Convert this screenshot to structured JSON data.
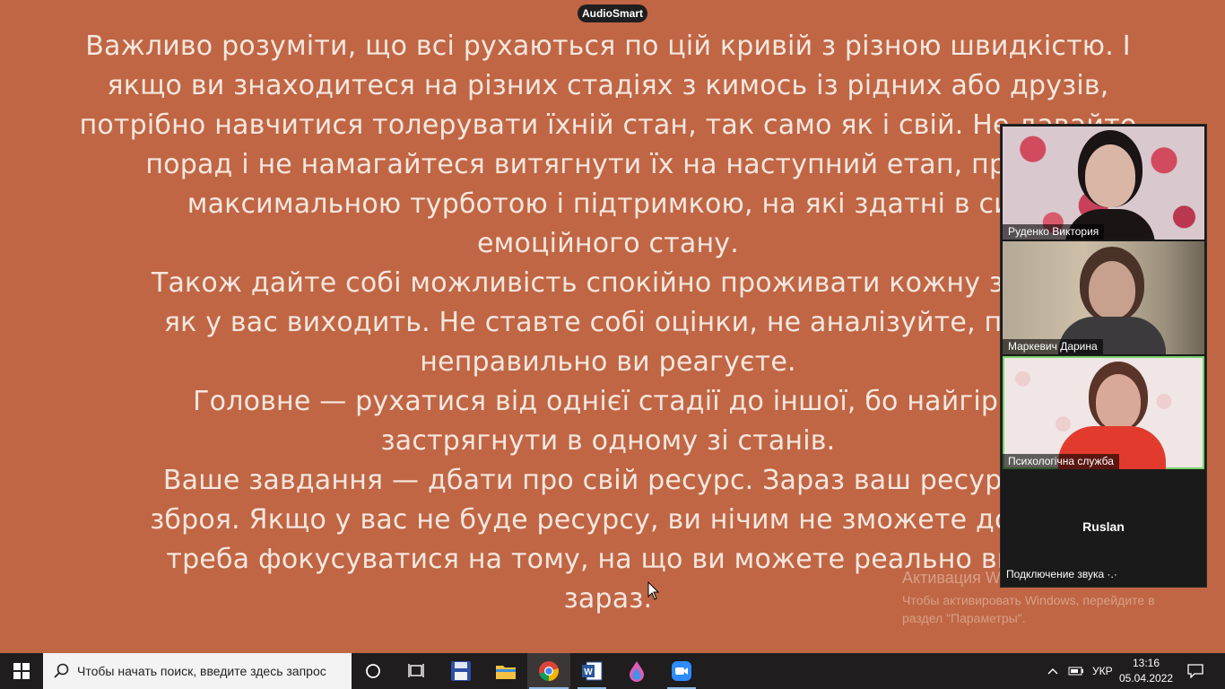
{
  "slide": {
    "lines": [
      "Важливо розуміти, що всі рухаються по цій кривій з різною швидкістю. І",
      "якщо ви знаходитеся на різних стадіях з кимось із рідних або друзів,",
      "потрібно навчитися толерувати їхній стан, так само як і свій. Не давайте",
      "порад і не намагайтеся витягнути їх на наступний етап, просто",
      "максимальною турботою і підтримкою, на які здатні в сил",
      "емоційного стану.",
      "Також дайте собі можливість спокійно проживати кожну з цих",
      "як у вас виходить. Не ставте собі оцінки, не аналізуйте, прав",
      "неправильно ви реагуєте.",
      "Головне — рухатися від однієї стадії до іншої, бо найгірш",
      "застрягнути в одному зі станів.",
      "Ваше завдання — дбати про свій ресурс. Зараз ваш ресурс —",
      "зброя. Якщо у вас не буде ресурсу, ви нічим не зможете допом",
      "треба фокусуватися на тому, на що ви можете реально впли",
      "зараз."
    ]
  },
  "badge": "AudioSmart",
  "watermark": {
    "title": "Активация W",
    "desc": "Чтобы активировать Windows, перейдите в раздел \"Параметры\"."
  },
  "participants": [
    {
      "name": "Руденко  Виктория"
    },
    {
      "name": "Маркевич Дарина"
    },
    {
      "name": "Психологічна служба"
    },
    {
      "name": "Ruslan",
      "status": "Подключение звука ·.·"
    }
  ],
  "taskbar": {
    "search_placeholder": "Чтобы начать поиск, введите здесь запрос",
    "apps": [
      "task-view",
      "floppy-save",
      "file-explorer",
      "chrome",
      "word",
      "paint-drop",
      "zoom"
    ],
    "language": "УКР",
    "time": "13:16",
    "date": "05.04.2022"
  },
  "colors": {
    "slide_bg": "#c06644",
    "slide_text": "#f6e7df",
    "taskbar_bg": "#1f1d1d",
    "active_speaker": "#7ad36b"
  }
}
